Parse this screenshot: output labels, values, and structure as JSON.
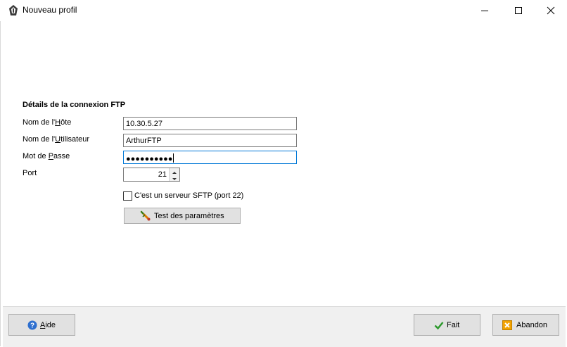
{
  "window": {
    "title": "Nouveau profil",
    "controls": {
      "minimize_icon": "minimize-icon",
      "maximize_icon": "maximize-icon",
      "close_icon": "close-icon"
    }
  },
  "form": {
    "section_title": "Détails de la connexion FTP",
    "host": {
      "label_pre": "Nom de l'",
      "label_accel": "H",
      "label_post": "ôte",
      "value": "10.30.5.27"
    },
    "user": {
      "label_pre": "Nom de l'",
      "label_accel": "U",
      "label_post": "tilisateur",
      "value": "ArthurFTP"
    },
    "password": {
      "label_pre": "Mot de ",
      "label_accel": "P",
      "label_post": "asse",
      "masked_value": "●●●●●●●●●●"
    },
    "port": {
      "label": "Port",
      "value": "21"
    },
    "sftp_checkbox": {
      "label": "C'est un serveur SFTP (port 22)",
      "checked": false
    },
    "test_button": {
      "label": "Test des paramètres",
      "icon": "test-connection-icon"
    }
  },
  "footer": {
    "help_button": {
      "label_accel": "A",
      "label_post": "ide",
      "icon": "help-icon"
    },
    "done_button": {
      "label": "Fait",
      "icon": "checkmark-icon"
    },
    "cancel_button": {
      "label": "Abandon",
      "icon": "cancel-icon"
    }
  },
  "colors": {
    "focus_border": "#0078d7",
    "footer_bg": "#f0f0f0",
    "button_bg": "#e1e1e1"
  }
}
